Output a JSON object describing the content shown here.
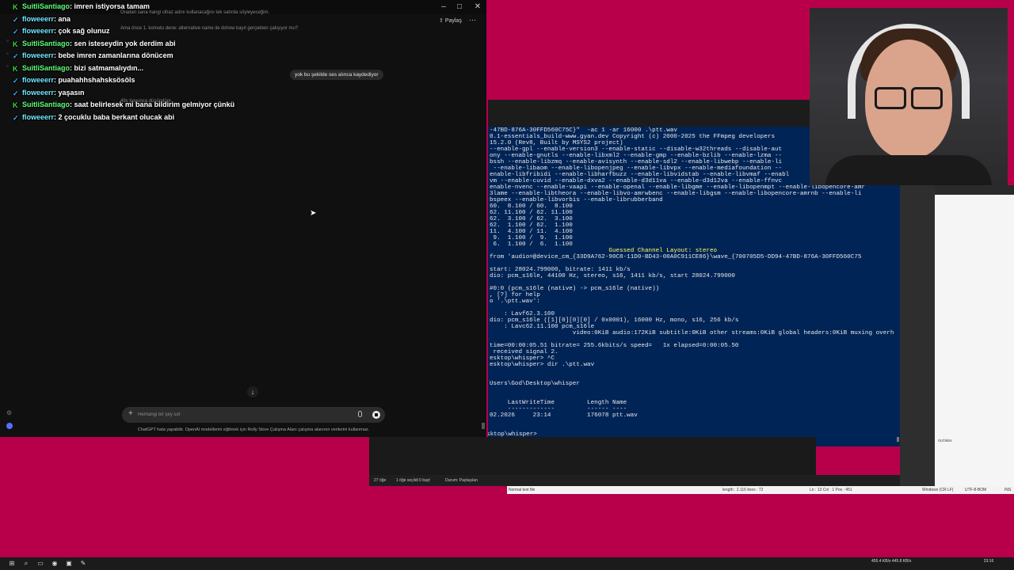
{
  "chat_window": {
    "share_label": "Paylaş",
    "bg_line_1": "Oradan sana hangi cihaz adını kullanacağını tek satırda söyleyeceğim.",
    "bg_line_2": "Ama önce 1. komutu dene: alternative name ile dshow kayıt gerçekten çalışıyor mu?",
    "bg_line_3": "49s boyunca düşündüm",
    "user_bubble": "yok bu şekilde ses alınca kaydediyor",
    "composer_placeholder": "Herhangi bir şey sor",
    "disclaimer": "ChatGPT hata yapabilir. OpenAI modellerini eğitmek için Rolly Store Çalışma Alanı çalışma alanının verilerini kullanmaz."
  },
  "chat_overlay": [
    {
      "badge": "green",
      "user": "SuitliSantiago",
      "msg": "imren istiyorsa tamam",
      "color": "green"
    },
    {
      "badge": "blue",
      "user": "floweeerr",
      "msg": "ana",
      "color": "cyan"
    },
    {
      "badge": "blue",
      "user": "floweeerr",
      "msg": "çok sağ olunuz",
      "color": "cyan"
    },
    {
      "badge": "green",
      "user": "SuitliSantiago",
      "msg": "sen isteseydin yok derdim abi",
      "color": "green"
    },
    {
      "badge": "blue",
      "user": "floweeerr",
      "msg": "bebe imren zamanlarına dönücem",
      "color": "cyan"
    },
    {
      "badge": "green",
      "user": "SuitliSantiago",
      "msg": "bizi satmamalıydın...",
      "color": "green"
    },
    {
      "badge": "blue",
      "user": "floweeerr",
      "msg": "puahahhshahsksösöls",
      "color": "cyan"
    },
    {
      "badge": "blue",
      "user": "floweeerr",
      "msg": "yaşasın",
      "color": "cyan"
    },
    {
      "badge": "green",
      "user": "SuitliSantiago",
      "msg": "saat belirlesek mi bana bildirim gelmiyor çünkü",
      "color": "green"
    },
    {
      "badge": "blue",
      "user": "floweeerr",
      "msg": "2 çocuklu baba berkant olucak abi",
      "color": "cyan"
    }
  ],
  "terminal": {
    "lines": [
      {
        "text": "-47BD-876A-30FFD560C75C}\"  -ac 1 -ar 16000 .\\ptt.wav",
        "style": ""
      },
      {
        "text": "0.1-essentials_build-www.gyan.dev Copyright (c) 2000-2025 the FFmpeg developers",
        "style": ""
      },
      {
        "text": "15.2.0 (Rev8, Built by MSYS2 project)",
        "style": ""
      },
      {
        "text": "--enable-gpl --enable-version3 --enable-static --disable-w32threads --disable-aut",
        "style": ""
      },
      {
        "text": "ony --enable-gnutls --enable-libxml2 --enable-gmp --enable-bzlib --enable-lzma --",
        "style": ""
      },
      {
        "text": "bssh --enable-libzmq --enable-avisynth --enable-sdl2 --enable-libwebp --enable-li",
        "style": ""
      },
      {
        "text": " --enable-libaom --enable-libopenjpeg --enable-libvpx --enable-mediafoundation --",
        "style": ""
      },
      {
        "text": "enable-libfribidi --enable-libharfbuzz --enable-libvidstab --enable-libvmaf --enabl",
        "style": ""
      },
      {
        "text": "vm --enable-cuvid --enable-dxva2 --enable-d3d11va --enable-d3d12va --enable-ffnvc",
        "style": ""
      },
      {
        "text": "enable-nvenc --enable-vaapi --enable-openal --enable-libgme --enable-libopenmpt --enable-libopencore-amr",
        "style": ""
      },
      {
        "text": "3lame --enable-libtheora --enable-libvo-amrwbenc --enable-libgsm --enable-libopencore-amrnb --enable-li",
        "style": ""
      },
      {
        "text": "bspeex --enable-libvorbis --enable-librubberband",
        "style": ""
      },
      {
        "text": "60.  8.100 / 60.  8.100",
        "style": ""
      },
      {
        "text": "62. 11.100 / 62. 11.100",
        "style": ""
      },
      {
        "text": "62.  3.100 / 62.  3.100",
        "style": ""
      },
      {
        "text": "62.  1.100 / 62.  1.100",
        "style": ""
      },
      {
        "text": "11.  4.100 / 11.  4.100",
        "style": ""
      },
      {
        "text": " 9.  1.100 /  9.  1.100",
        "style": ""
      },
      {
        "text": " 6.  1.100 /  6.  1.100",
        "style": ""
      },
      {
        "text": "                                 Guessed Channel Layout: stereo",
        "style": "yellow"
      },
      {
        "text": "from 'audio=@device_cm_{33D9A762-90C8-11D0-BD43-00A0C911CE86}\\wave_{700705D5-DD94-47BD-876A-30FFD560C75",
        "style": ""
      },
      {
        "text": "",
        "style": ""
      },
      {
        "text": "start: 28024.799000, bitrate: 1411 kb/s",
        "style": ""
      },
      {
        "text": "dio: pcm_s16le, 44100 Hz, stereo, s16, 1411 kb/s, start 28024.799000",
        "style": ""
      },
      {
        "text": "",
        "style": ""
      },
      {
        "text": "#0:0 (pcm_s16le (native) -> pcm_s16le (native))",
        "style": ""
      },
      {
        "text": ", [?] for help",
        "style": ""
      },
      {
        "text": "o '.\\ptt.wav':",
        "style": ""
      },
      {
        "text": "",
        "style": ""
      },
      {
        "text": "    : Lavf62.3.100",
        "style": ""
      },
      {
        "text": "dio: pcm_s16le ([1][0][0][0] / 0x0001), 16000 Hz, mono, s16, 256 kb/s",
        "style": ""
      },
      {
        "text": "    : Lavc62.11.100 pcm_s16le",
        "style": ""
      },
      {
        "text": "                       video:0KiB audio:172KiB subtitle:0KiB other streams:0KiB global headers:0KiB muxing overh",
        "style": ""
      },
      {
        "text": "",
        "style": ""
      },
      {
        "text": "time=00:00:05.51 bitrate= 255.6kbits/s speed=   1x elapsed=0:00:05.50",
        "style": ""
      },
      {
        "text": " received signal 2.",
        "style": ""
      },
      {
        "text": "esktop\\whisper> ^C",
        "style": ""
      },
      {
        "text": "esktop\\whisper> dir .\\ptt.wav",
        "style": ""
      },
      {
        "text": "",
        "style": ""
      },
      {
        "text": "",
        "style": ""
      },
      {
        "text": "Users\\God\\Desktop\\whisper",
        "style": ""
      },
      {
        "text": "",
        "style": ""
      },
      {
        "text": "",
        "style": ""
      },
      {
        "text": "     LastWriteTime         Length Name",
        "style": ""
      },
      {
        "text": "     -------------         ------ ----",
        "style": ""
      },
      {
        "text": "02.2026     23:14          176078 ptt.wav",
        "style": ""
      }
    ],
    "prompt": "PS C:\\Users\\God\\Desktop\\whisper>"
  },
  "explorer_status": {
    "items": "27 öğe",
    "selected": "1 öğe seçildi 0 bayt",
    "state": "Durum: Paylaşılan"
  },
  "notepad_status": {
    "type": "Normal text file",
    "length": "length : 2.116   lines : 72",
    "position": "Ln : 13   Col : 1   Pos : 451",
    "eol": "Windows (CR LF)",
    "encoding": "UTF-8-BOM",
    "mode": "INS"
  },
  "side_text": "outWav",
  "tray": {
    "net_up": "455.4 KB/s",
    "net_down": "445.8 KB/s",
    "time": "23:16"
  }
}
